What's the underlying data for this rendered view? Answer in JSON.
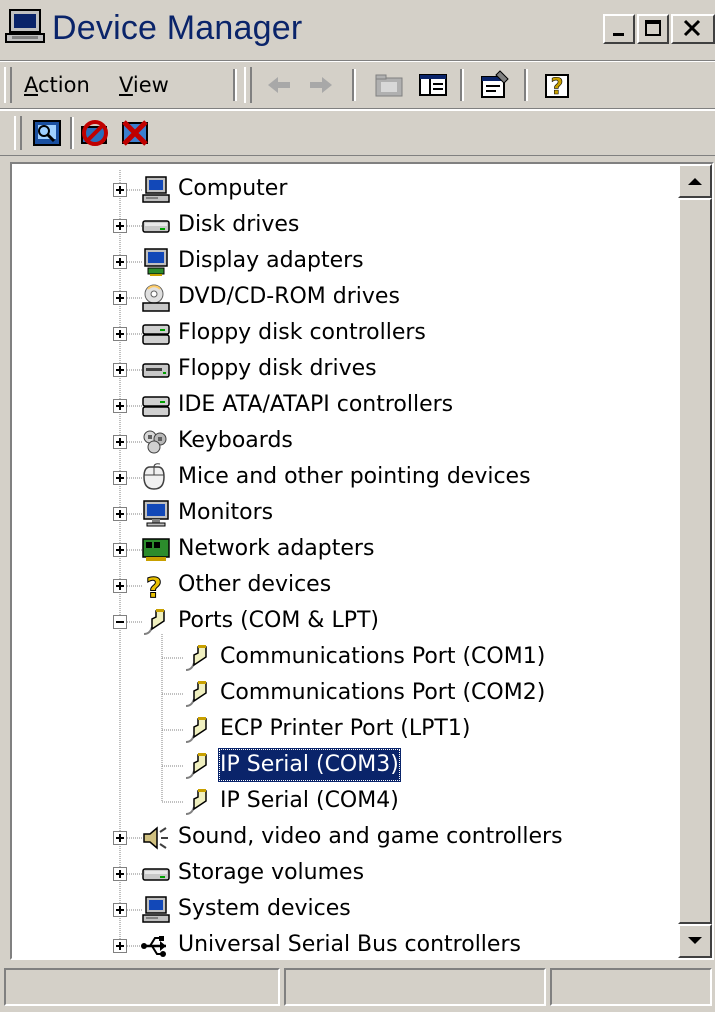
{
  "window": {
    "title": "Device Manager",
    "icon": "device-manager-icon",
    "caption_buttons": [
      "minimize-icon",
      "maximize-icon",
      "close-icon"
    ]
  },
  "menu": {
    "items": [
      {
        "label": "Action",
        "accel": "A"
      },
      {
        "label": "View",
        "accel": "V"
      }
    ]
  },
  "toolbar": {
    "buttons": [
      "back-arrow-icon",
      "forward-arrow-icon",
      "up-folder-icon",
      "show-hide-tree-icon",
      "properties-icon",
      "help-icon"
    ]
  },
  "toolbar2": {
    "buttons": [
      "scan-hardware-icon",
      "disable-device-icon",
      "uninstall-device-icon"
    ]
  },
  "tree": {
    "categories": [
      {
        "label": "Computer",
        "icon": "computer-icon",
        "expanded": false
      },
      {
        "label": "Disk drives",
        "icon": "disk-drive-icon",
        "expanded": false
      },
      {
        "label": "Display adapters",
        "icon": "display-adapter-icon",
        "expanded": false
      },
      {
        "label": "DVD/CD-ROM drives",
        "icon": "cdrom-icon",
        "expanded": false
      },
      {
        "label": "Floppy disk controllers",
        "icon": "controller-icon",
        "expanded": false
      },
      {
        "label": "Floppy disk drives",
        "icon": "floppy-drive-icon",
        "expanded": false
      },
      {
        "label": "IDE ATA/ATAPI controllers",
        "icon": "controller-icon",
        "expanded": false
      },
      {
        "label": "Keyboards",
        "icon": "keyboard-icon",
        "expanded": false
      },
      {
        "label": "Mice and other pointing devices",
        "icon": "mouse-icon",
        "expanded": false
      },
      {
        "label": "Monitors",
        "icon": "monitor-icon",
        "expanded": false
      },
      {
        "label": "Network adapters",
        "icon": "network-adapter-icon",
        "expanded": false
      },
      {
        "label": "Other devices",
        "icon": "question-mark-icon",
        "expanded": false
      },
      {
        "label": "Ports (COM & LPT)",
        "icon": "port-connector-icon",
        "expanded": true,
        "children": [
          {
            "label": "Communications Port (COM1)",
            "icon": "port-connector-icon",
            "selected": false
          },
          {
            "label": "Communications Port (COM2)",
            "icon": "port-connector-icon",
            "selected": false
          },
          {
            "label": "ECP Printer Port (LPT1)",
            "icon": "port-connector-icon",
            "selected": false
          },
          {
            "label": "IP Serial (COM3)",
            "icon": "port-connector-icon",
            "selected": true
          },
          {
            "label": "IP Serial (COM4)",
            "icon": "port-connector-icon",
            "selected": false
          }
        ]
      },
      {
        "label": "Sound, video and game controllers",
        "icon": "speaker-icon",
        "expanded": false
      },
      {
        "label": "Storage volumes",
        "icon": "disk-drive-icon",
        "expanded": false
      },
      {
        "label": "System devices",
        "icon": "computer-icon",
        "expanded": false
      },
      {
        "label": "Universal Serial Bus controllers",
        "icon": "usb-icon",
        "expanded": false
      }
    ]
  },
  "statusbar": {
    "panes": [
      "",
      "",
      ""
    ]
  },
  "colors": {
    "selection": "#0a246a",
    "face": "#d4d0c8",
    "title_text": "#0a246a"
  }
}
